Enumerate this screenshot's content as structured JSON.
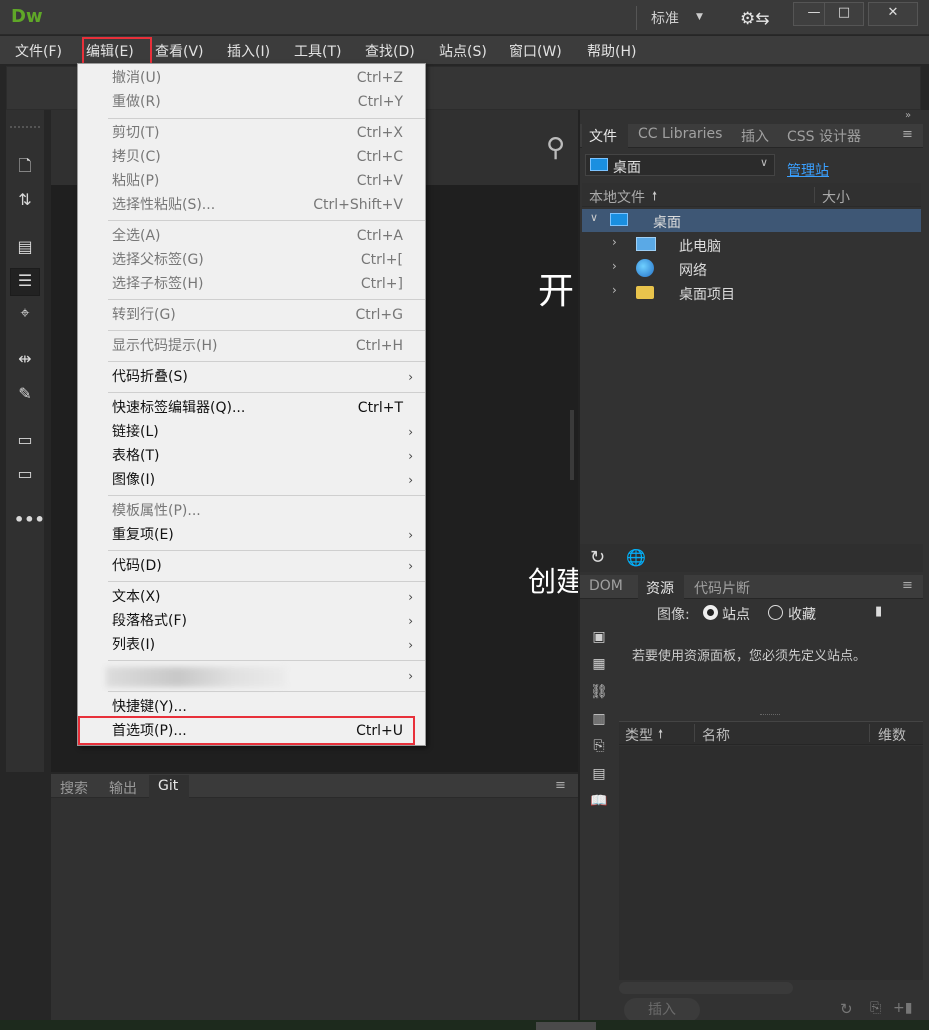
{
  "app": {
    "logo": "Dw",
    "workspace": "标准",
    "sync_icon": "gear-sync-icon",
    "win_min": "—",
    "win_max": "□",
    "win_close": "✕"
  },
  "menubar": [
    "文件(F)",
    "编辑(E)",
    "查看(V)",
    "插入(I)",
    "工具(T)",
    "查找(D)",
    "站点(S)",
    "窗口(W)",
    "帮助(H)"
  ],
  "edit_menu": {
    "undo": {
      "label": "撤消(U)",
      "shortcut": "Ctrl+Z"
    },
    "redo": {
      "label": "重做(R)",
      "shortcut": "Ctrl+Y"
    },
    "cut": {
      "label": "剪切(T)",
      "shortcut": "Ctrl+X"
    },
    "copy": {
      "label": "拷贝(C)",
      "shortcut": "Ctrl+C"
    },
    "paste": {
      "label": "粘贴(P)",
      "shortcut": "Ctrl+V"
    },
    "paste_special": {
      "label": "选择性粘贴(S)...",
      "shortcut": "Ctrl+Shift+V"
    },
    "select_all": {
      "label": "全选(A)",
      "shortcut": "Ctrl+A"
    },
    "select_parent": {
      "label": "选择父标签(G)",
      "shortcut": "Ctrl+["
    },
    "select_child": {
      "label": "选择子标签(H)",
      "shortcut": "Ctrl+]"
    },
    "goto_line": {
      "label": "转到行(G)",
      "shortcut": "Ctrl+G"
    },
    "code_hints": {
      "label": "显示代码提示(H)",
      "shortcut": "Ctrl+H"
    },
    "code_collapse": {
      "label": "代码折叠(S)"
    },
    "quick_tag": {
      "label": "快速标签编辑器(Q)...",
      "shortcut": "Ctrl+T"
    },
    "link": {
      "label": "链接(L)"
    },
    "table": {
      "label": "表格(T)"
    },
    "image": {
      "label": "图像(I)"
    },
    "template_props": {
      "label": "模板属性(P)..."
    },
    "repeating": {
      "label": "重复项(E)"
    },
    "code": {
      "label": "代码(D)"
    },
    "text": {
      "label": "文本(X)"
    },
    "paragraph": {
      "label": "段落格式(F)"
    },
    "list": {
      "label": "列表(I)"
    },
    "keyboard_shortcuts": {
      "label": "快捷键(Y)..."
    },
    "preferences": {
      "label": "首选项(P)...",
      "shortcut": "Ctrl+U"
    },
    "submenu_arrow": "›"
  },
  "document": {
    "heading_fragment": "开",
    "sub_fragment": "创建"
  },
  "bottom_panel": {
    "tabs": [
      "搜索",
      "输出",
      "Git"
    ],
    "active": "Git"
  },
  "files_panel": {
    "tabs": [
      "文件",
      "CC Libraries",
      "插入",
      "CSS 设计器"
    ],
    "site": "桌面",
    "manage_site": "管理站",
    "col_local": "本地文件",
    "col_size": "大小",
    "sort_arrow": "🠕",
    "tree": [
      {
        "label": "桌面",
        "icon": "desktop-icon",
        "expanded": true,
        "selected": true
      },
      {
        "label": "此电脑",
        "icon": "computer-icon"
      },
      {
        "label": "网络",
        "icon": "network-icon"
      },
      {
        "label": "桌面项目",
        "icon": "folder-icon"
      }
    ]
  },
  "assets_panel": {
    "tabs": [
      "DOM",
      "资源",
      "代码片断"
    ],
    "image_label": "图像:",
    "radio_site": "站点",
    "radio_fav": "收藏",
    "message": "若要使用资源面板，您必须先定义站点。",
    "col_type": "类型",
    "col_name": "名称",
    "col_dim": "维数",
    "insert_button": "插入"
  },
  "colors": {
    "accent_highlight": "#e8303a",
    "logo_green": "#5fa728",
    "link_blue": "#3aa0ff",
    "selection": "#3e5775"
  }
}
